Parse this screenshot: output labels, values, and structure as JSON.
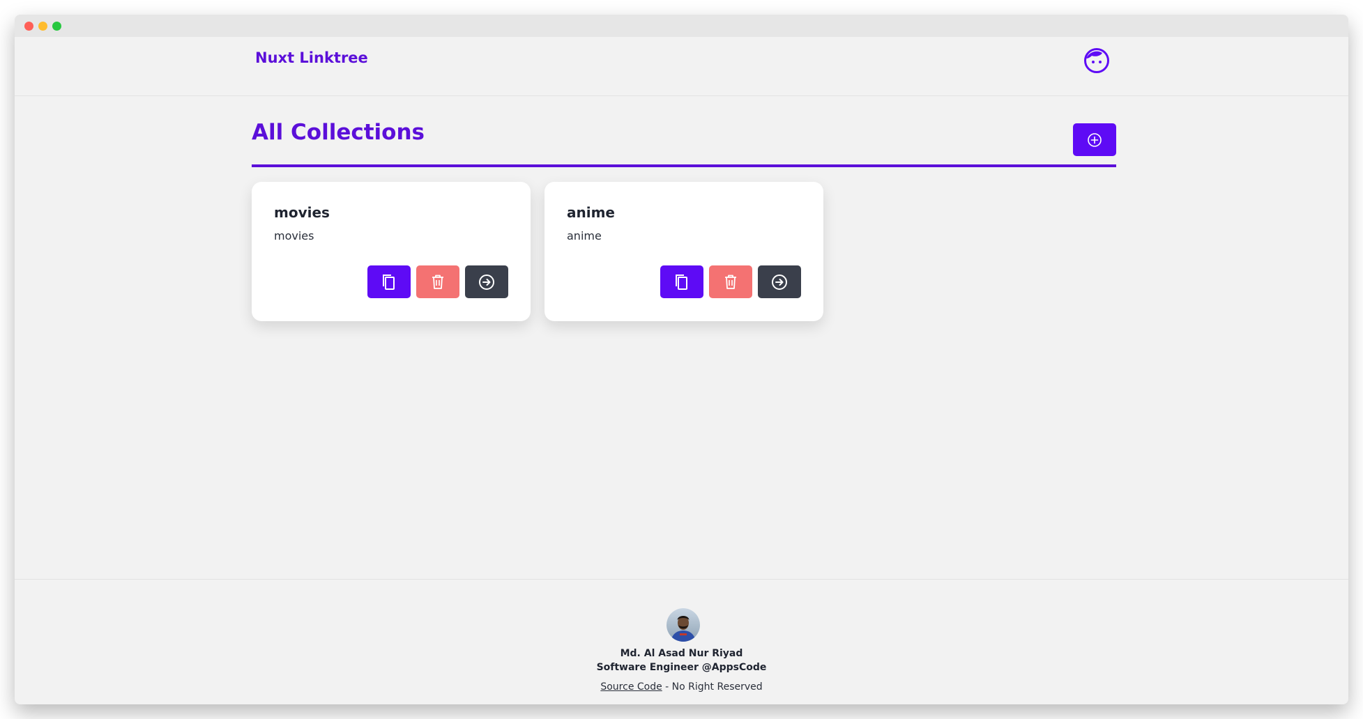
{
  "app": {
    "brand": "Nuxt Linktree",
    "avatar_icon": "face-icon"
  },
  "page": {
    "title": "All Collections",
    "add_icon": "plus-circle-icon"
  },
  "collections": [
    {
      "title": "movies",
      "description": "movies"
    },
    {
      "title": "anime",
      "description": "anime"
    }
  ],
  "card_actions": {
    "copy_icon": "copy-icon",
    "delete_icon": "trash-icon",
    "open_icon": "arrow-right-circle-icon"
  },
  "footer": {
    "name": "Md. Al Asad Nur Riyad",
    "role": "Software Engineer @AppsCode",
    "source_link": "Source Code",
    "rights": " - No Right Reserved"
  },
  "colors": {
    "accent": "#5e0bf5",
    "danger": "#f47272",
    "dark": "#3a3f4b",
    "background": "#f2f2f2"
  }
}
